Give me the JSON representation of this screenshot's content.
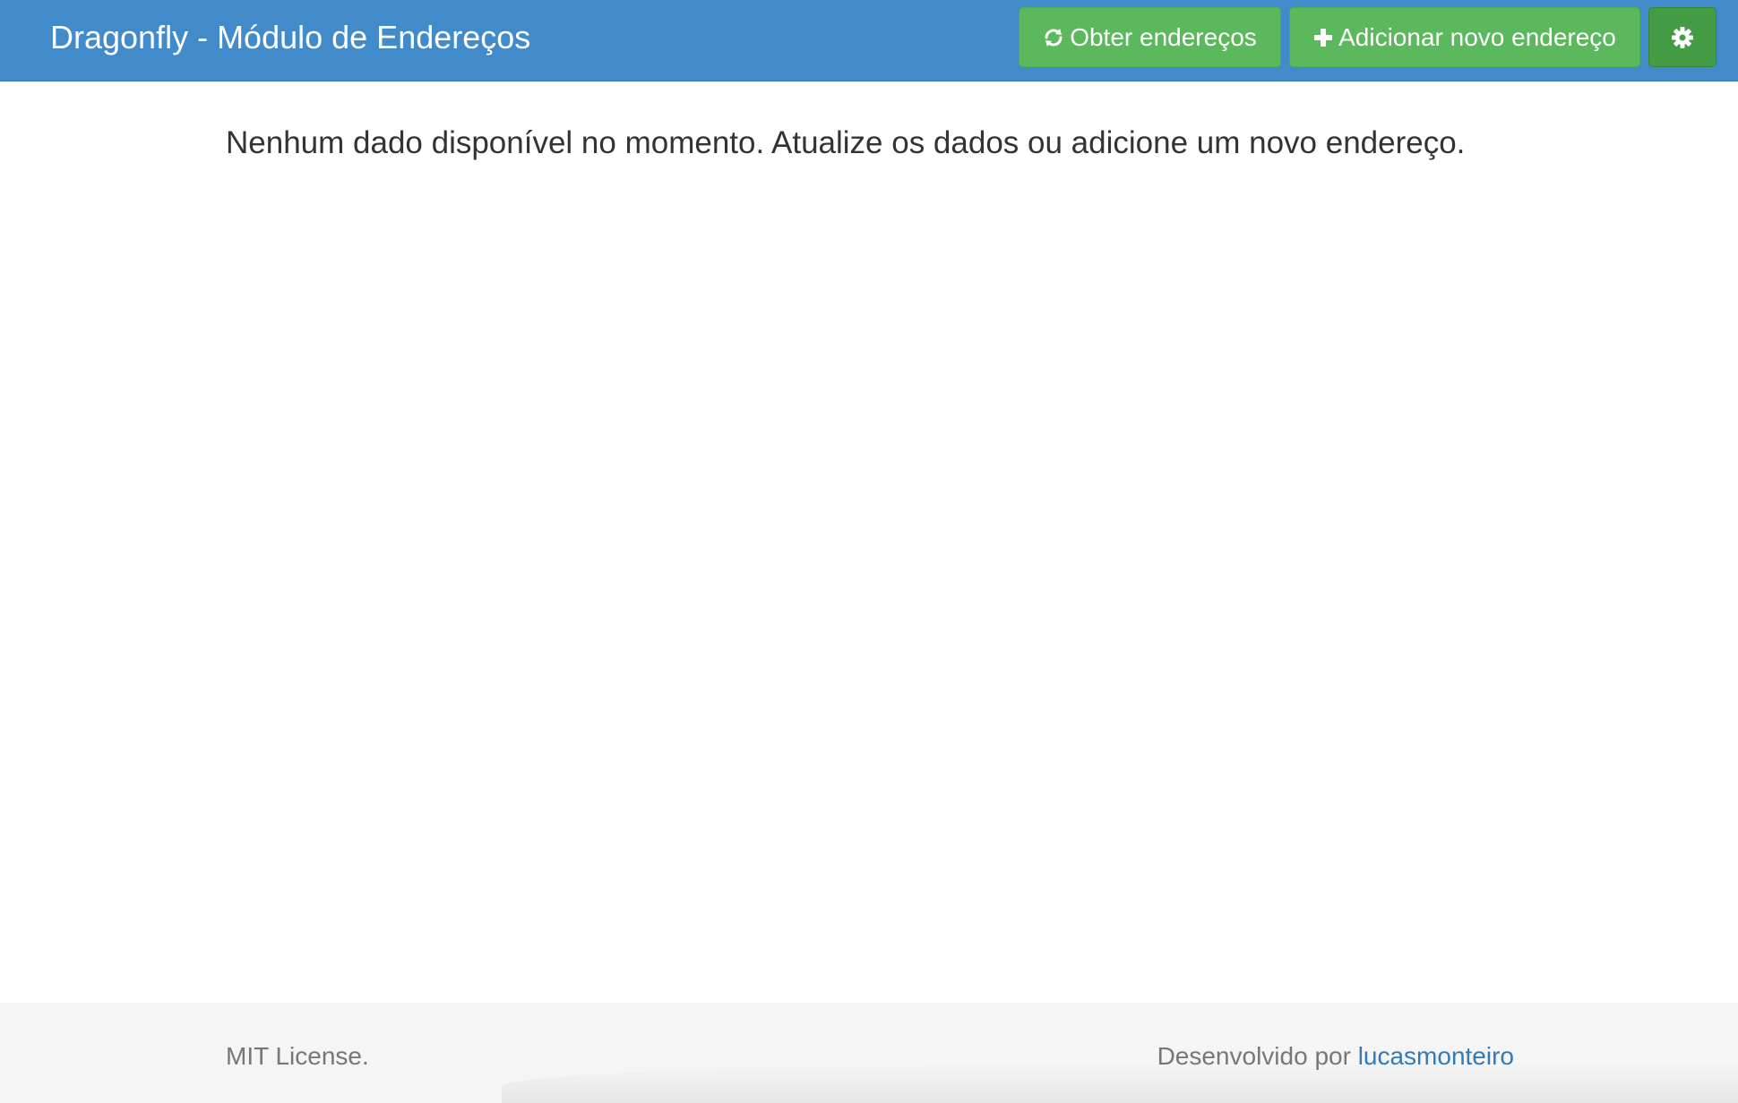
{
  "header": {
    "brand_title": "Dragonfly - Módulo de Endereços",
    "fetch_button_label": "Obter endereços",
    "add_button_label": "Adicionar novo endereço",
    "fetch_icon": "refresh-icon",
    "add_icon": "plus-icon",
    "settings_icon": "gear-icon"
  },
  "main": {
    "empty_message": "Nenhum dado disponível no momento. Atualize os dados ou adicione um novo endereço."
  },
  "footer": {
    "license_text": "MIT License.",
    "credit_prefix": "Desenvolvido por",
    "credit_link": "lucasmonteiro"
  },
  "colors": {
    "navbar": "#428bca",
    "button_success": "#5cb85c",
    "button_success_active": "#449d44",
    "link": "#337ab7",
    "footer_bg": "#f5f5f5"
  }
}
